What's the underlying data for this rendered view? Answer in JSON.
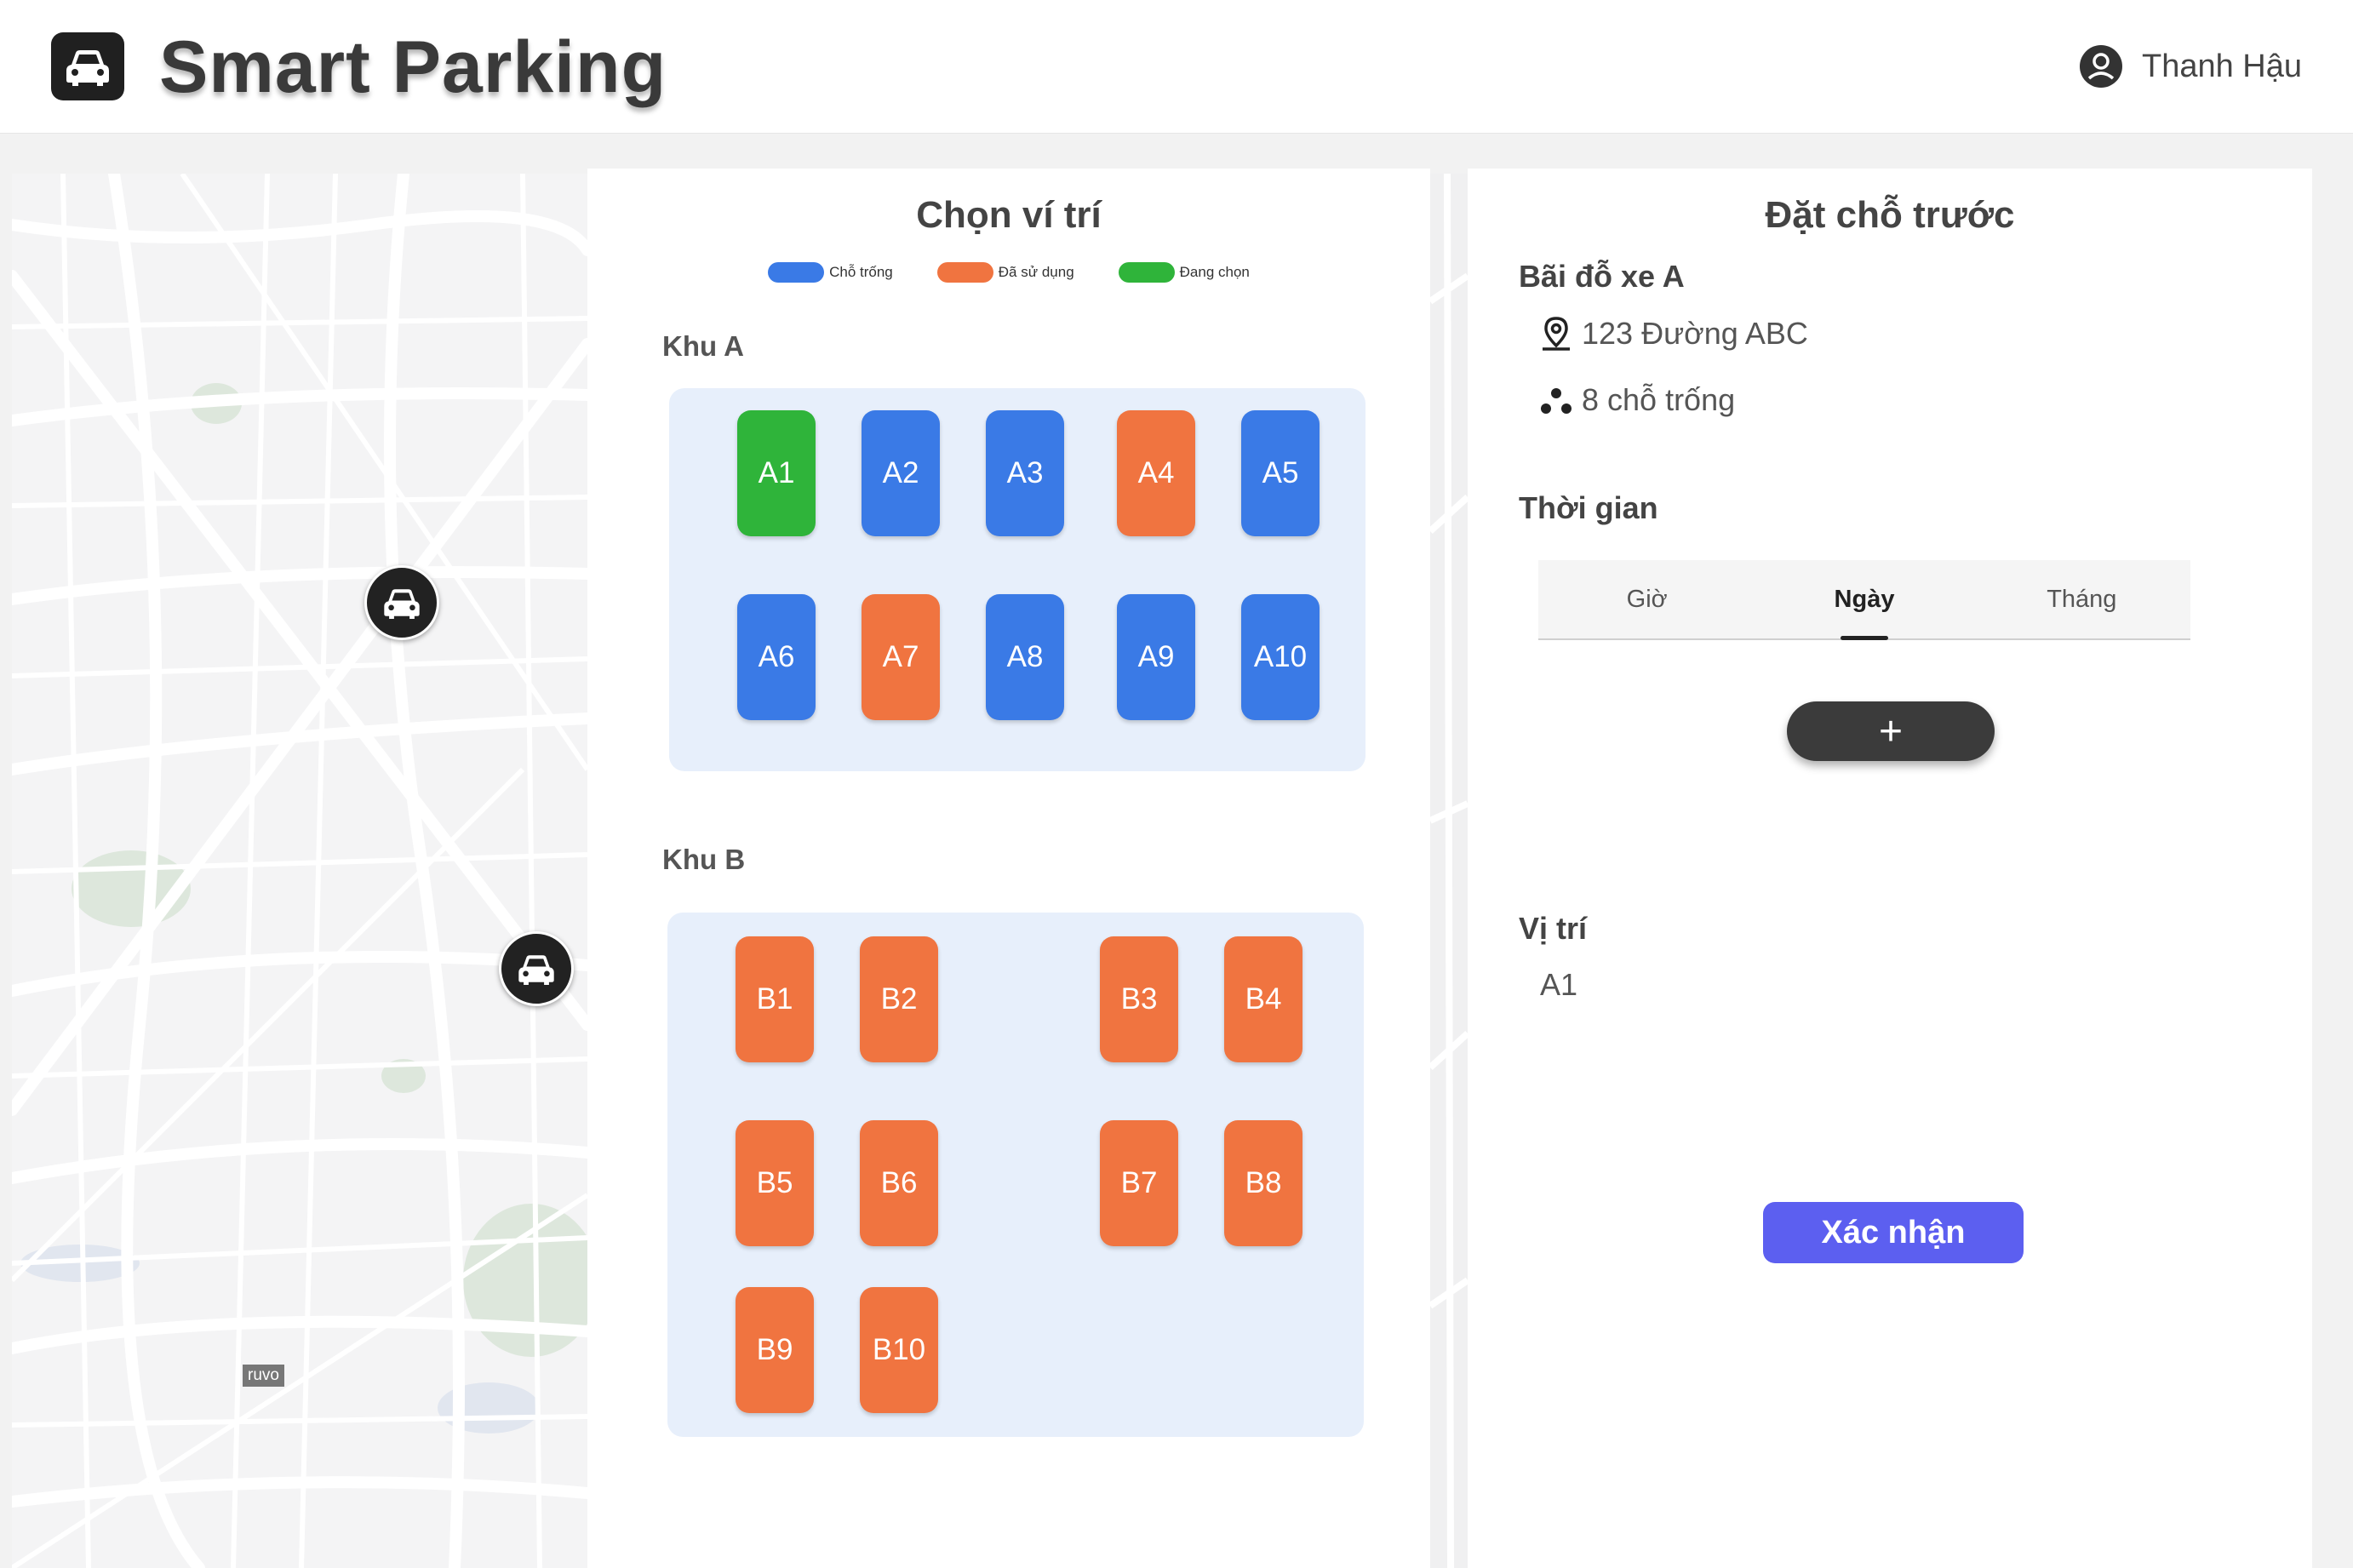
{
  "app": {
    "title": "Smart Parking",
    "logo_icon": "car-icon"
  },
  "user": {
    "name": "Thanh Hậu",
    "icon": "user-icon"
  },
  "map": {
    "label": "ruvo",
    "marker_icon": "car-icon"
  },
  "selector": {
    "title": "Chọn ví trí",
    "legend": [
      {
        "label": "Chỗ trống",
        "color": "#3a7ae6"
      },
      {
        "label": "Đã sử dụng",
        "color": "#f07440"
      },
      {
        "label": "Đang chọn",
        "color": "#2fb43a"
      }
    ],
    "zones": [
      {
        "name": "Khu A",
        "slots": [
          {
            "label": "A1",
            "status": "selected"
          },
          {
            "label": "A2",
            "status": "free"
          },
          {
            "label": "A3",
            "status": "free"
          },
          {
            "label": "A4",
            "status": "used"
          },
          {
            "label": "A5",
            "status": "free"
          },
          {
            "label": "A6",
            "status": "free"
          },
          {
            "label": "A7",
            "status": "used"
          },
          {
            "label": "A8",
            "status": "free"
          },
          {
            "label": "A9",
            "status": "free"
          },
          {
            "label": "A10",
            "status": "free"
          }
        ]
      },
      {
        "name": "Khu B",
        "slots": [
          {
            "label": "B1",
            "status": "used"
          },
          {
            "label": "B2",
            "status": "used"
          },
          {
            "label": "B3",
            "status": "used"
          },
          {
            "label": "B4",
            "status": "used"
          },
          {
            "label": "B5",
            "status": "used"
          },
          {
            "label": "B6",
            "status": "used"
          },
          {
            "label": "B7",
            "status": "used"
          },
          {
            "label": "B8",
            "status": "used"
          },
          {
            "label": "B9",
            "status": "used"
          },
          {
            "label": "B10",
            "status": "used"
          }
        ]
      }
    ]
  },
  "booking": {
    "title": "Đặt chỗ trước",
    "lot_name": "Bãi đỗ xe A",
    "address": "123 Đường ABC",
    "address_icon": "location-pin-icon",
    "availability": "8 chỗ trống",
    "availability_icon": "dots-icon",
    "time_title": "Thời gian",
    "tabs": [
      {
        "label": "Giờ",
        "active": false
      },
      {
        "label": "Ngày",
        "active": true
      },
      {
        "label": "Tháng",
        "active": false
      }
    ],
    "add_label": "+",
    "position_title": "Vị trí",
    "position_value": "A1",
    "confirm_label": "Xác nhận"
  }
}
